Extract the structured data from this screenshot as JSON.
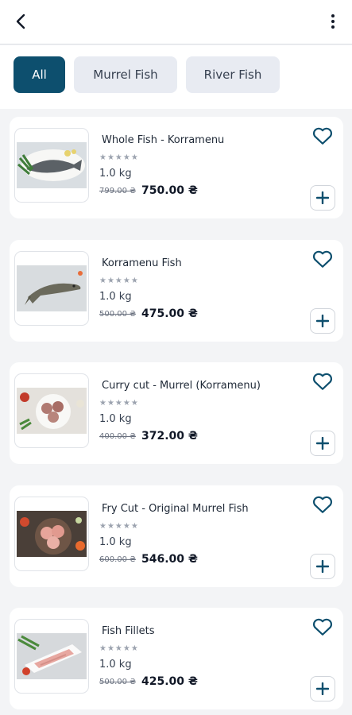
{
  "header": {
    "back_icon": "arrow-left-icon",
    "menu_icon": "more-vertical-icon"
  },
  "filters": [
    {
      "label": "All",
      "active": true
    },
    {
      "label": "Murrel Fish",
      "active": false
    },
    {
      "label": "River Fish",
      "active": false
    }
  ],
  "products": [
    {
      "name": "Whole Fish - Korramenu",
      "stars": "★★★★★",
      "weight": "1.0 kg",
      "mrp": "799.00 ₴",
      "price": "750.00 ₴"
    },
    {
      "name": "Korramenu Fish",
      "stars": "★★★★★",
      "weight": "1.0 kg",
      "mrp": "500.00 ₴",
      "price": "475.00 ₴"
    },
    {
      "name": "Curry cut - Murrel (Korramenu)",
      "stars": "★★★★★",
      "weight": "1.0 kg",
      "mrp": "400.00 ₴",
      "price": "372.00 ₴"
    },
    {
      "name": "Fry Cut - Original Murrel Fish",
      "stars": "★★★★★",
      "weight": "1.0 kg",
      "mrp": "600.00 ₴",
      "price": "546.00 ₴"
    },
    {
      "name": "Fish Fillets",
      "stars": "★★★★★",
      "weight": "1.0 kg",
      "mrp": "500.00 ₴",
      "price": "425.00 ₴"
    }
  ],
  "colors": {
    "accent": "#0d4f6e",
    "chip_inactive": "#e8ebf2",
    "background": "#f3f4f6"
  }
}
